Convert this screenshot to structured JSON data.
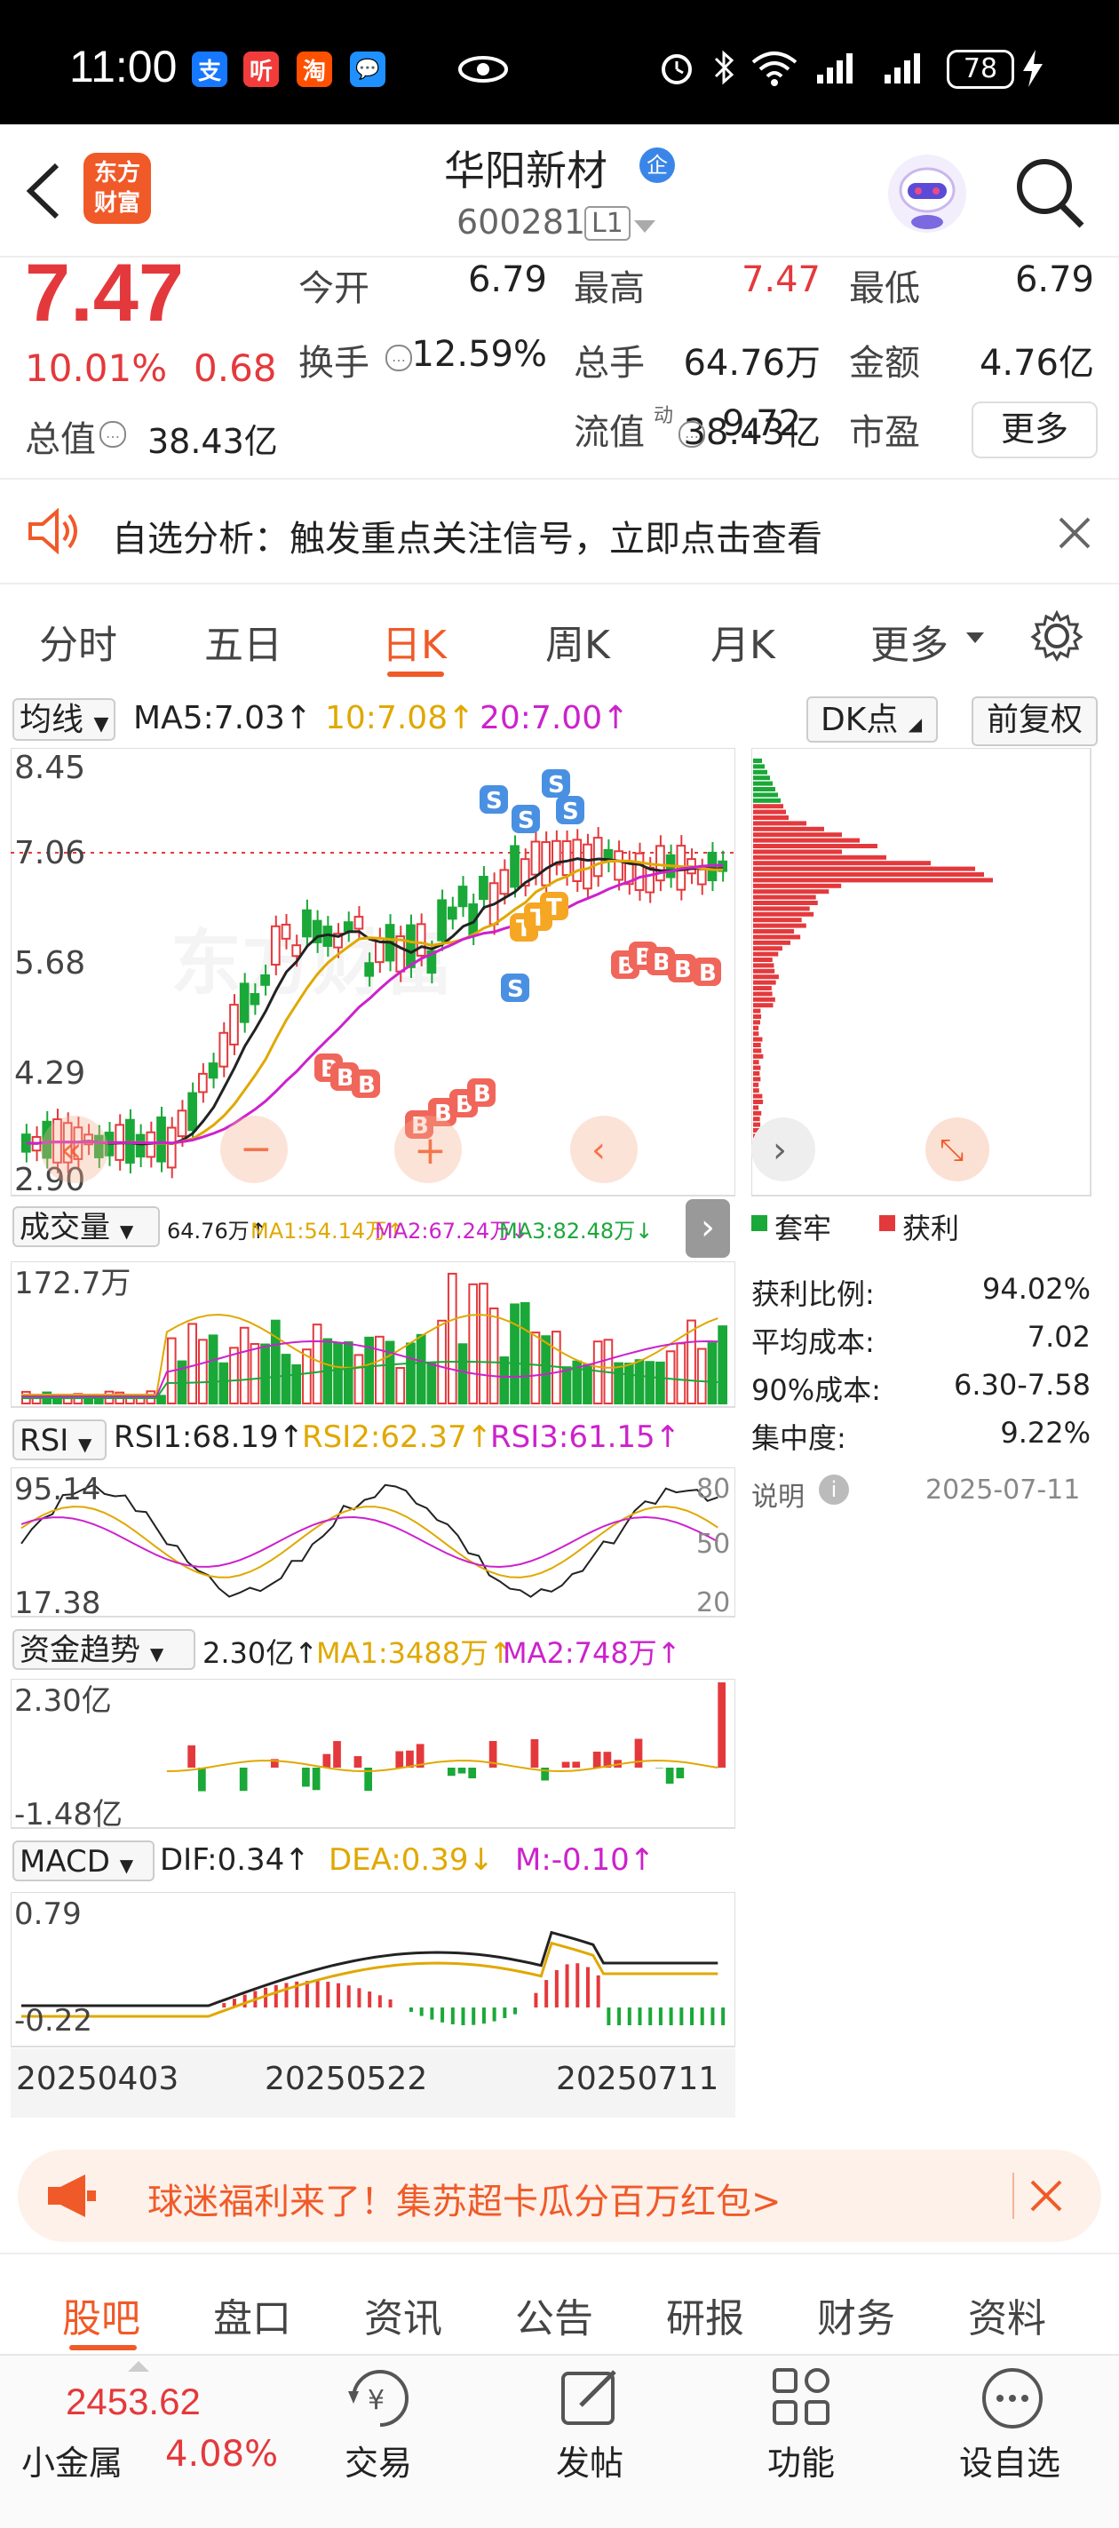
{
  "status_bar": {
    "time": "11:00",
    "battery": "78",
    "apps": [
      "支",
      "听",
      "淘",
      "💬"
    ]
  },
  "header": {
    "brand": "东方\n财富",
    "stock_name": "华阳新材",
    "stock_badge": "企",
    "stock_code": "600281",
    "level": "L1"
  },
  "quote": {
    "price": "7.47",
    "pct": "10.01%",
    "change": "0.68",
    "rows": [
      [
        {
          "label": "今开",
          "value": "6.79",
          "color": "#222"
        },
        {
          "label": "最高",
          "value": "7.47",
          "color": "#e4393c"
        },
        {
          "label": "最低",
          "value": "6.79",
          "color": "#222"
        }
      ],
      [
        {
          "label": "换手",
          "value": "12.59%",
          "color": "#222"
        },
        {
          "label": "总手",
          "value": "64.76万",
          "color": "#222"
        },
        {
          "label": "金额",
          "value": "4.76亿",
          "color": "#222"
        }
      ],
      [
        {
          "label": "总值",
          "value": "38.43亿",
          "color": "#222"
        },
        {
          "label": "流值",
          "value": "38.43亿",
          "color": "#222"
        },
        {
          "label": "市盈",
          "value": "9.72",
          "color": "#222"
        }
      ]
    ],
    "more_label": "更多",
    "pe_sup": "动"
  },
  "alert": {
    "text": "自选分析：触发重点关注信号，立即点击查看"
  },
  "period_tabs": [
    "分时",
    "五日",
    "日K",
    "周K",
    "月K",
    "更多"
  ],
  "active_tab": 2,
  "kline": {
    "ma_selector": "均线",
    "ma5": "MA5:7.03",
    "ma10": "10:7.08",
    "ma20": "20:7.00",
    "dk_label": "DK点",
    "adjust_label": "前复权",
    "y_ticks": [
      "8.45",
      "7.06",
      "5.68",
      "4.29",
      "2.90"
    ],
    "watermark": "东方财富"
  },
  "chip": {
    "legend_locked": "套牢",
    "legend_profit": "获利",
    "stats": [
      {
        "label": "获利比例:",
        "value": "94.02%"
      },
      {
        "label": "平均成本:",
        "value": "7.02"
      },
      {
        "label": "90%成本:",
        "value": "6.30-7.58"
      },
      {
        "label": "集中度:",
        "value": "9.22%"
      }
    ],
    "note_label": "说明",
    "date": "2025-07-11"
  },
  "volume": {
    "selector": "成交量",
    "value": "64.76万",
    "ma1": "MA1:54.14万",
    "ma2": "MA2:67.24万",
    "ma3": "MA3:82.48万",
    "y_top": "172.7万"
  },
  "rsi": {
    "selector": "RSI",
    "rsi1": "RSI1:68.19",
    "rsi2": "RSI2:62.37",
    "rsi3": "RSI3:61.15",
    "y_top": "95.14",
    "y_bottom": "17.38",
    "right_top": "80",
    "right_mid": "50",
    "right_bottom": "20"
  },
  "fund": {
    "selector": "资金趋势",
    "value": "2.30亿",
    "ma1": "MA1:3488万",
    "ma2": "MA2:748万",
    "y_top": "2.30亿",
    "y_bottom": "-1.48亿"
  },
  "macd": {
    "selector": "MACD",
    "dif": "DIF:0.34",
    "dea": "DEA:0.39",
    "m": "M:-0.10",
    "y_top": "0.79",
    "y_bottom": "-0.22"
  },
  "dates": [
    "20250403",
    "20250522",
    "20250711"
  ],
  "promo": {
    "text": "球迷福利来了！集苏超卡瓜分百万红包>"
  },
  "bottom_tabs": [
    "股吧",
    "盘口",
    "资讯",
    "公告",
    "研报",
    "财务",
    "资料"
  ],
  "bottom_nav": {
    "index_value": "2453.62",
    "index_name": "小金属",
    "index_pct": "4.08%",
    "items": [
      "交易",
      "发帖",
      "功能",
      "设自选"
    ]
  },
  "colors": {
    "up": "#e4393c",
    "down": "#1aa838",
    "ma5": "#222222",
    "ma10": "#e0a800",
    "ma20": "#cc22cc",
    "accent": "#f05a28"
  }
}
